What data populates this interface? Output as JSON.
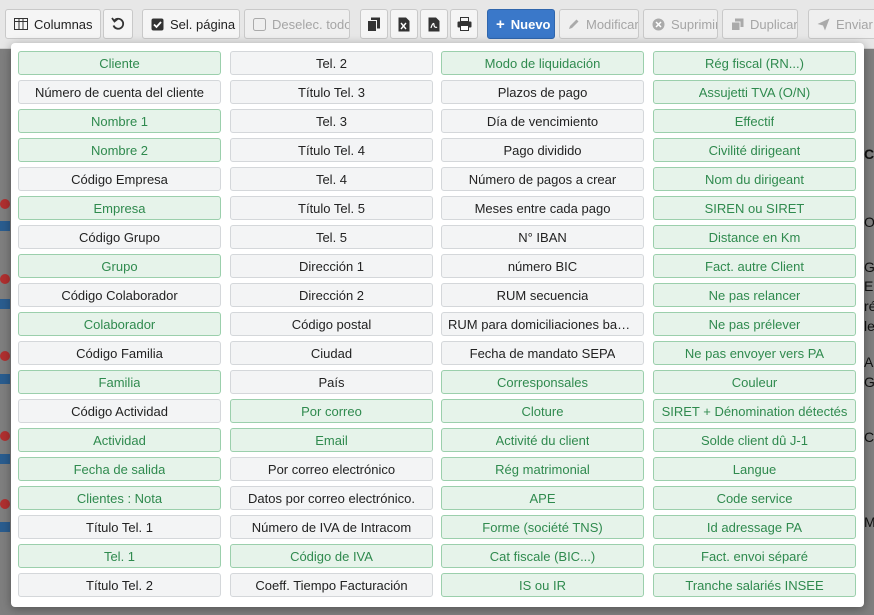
{
  "toolbar": {
    "columns_label": "Columnas",
    "select_page_label": "Sel. página",
    "deselect_all_label": "Deselec. todo",
    "new_label": "Nuevo",
    "modify_label": "Modificar",
    "delete_label": "Suprimir",
    "duplicate_label": "Duplicar",
    "send_label": "Enviar"
  },
  "background": {
    "letters": [
      "C",
      "O",
      "G",
      "E",
      "ré",
      "le",
      "A",
      "G",
      "C",
      "M"
    ]
  },
  "columns": [
    [
      {
        "label": "Cliente",
        "selected": true
      },
      {
        "label": "Número de cuenta del cliente",
        "selected": false
      },
      {
        "label": "Nombre 1",
        "selected": true
      },
      {
        "label": "Nombre 2",
        "selected": true
      },
      {
        "label": "Código Empresa",
        "selected": false
      },
      {
        "label": "Empresa",
        "selected": true
      },
      {
        "label": "Código Grupo",
        "selected": false
      },
      {
        "label": "Grupo",
        "selected": true
      },
      {
        "label": "Código Colaborador",
        "selected": false
      },
      {
        "label": "Colaborador",
        "selected": true
      },
      {
        "label": "Código Familia",
        "selected": false
      },
      {
        "label": "Familia",
        "selected": true
      },
      {
        "label": "Código Actividad",
        "selected": false
      },
      {
        "label": "Actividad",
        "selected": true
      },
      {
        "label": "Fecha de salida",
        "selected": true
      },
      {
        "label": "Clientes : Nota",
        "selected": true
      },
      {
        "label": "Título Tel. 1",
        "selected": false
      },
      {
        "label": "Tel. 1",
        "selected": true
      },
      {
        "label": "Título Tel. 2",
        "selected": false
      }
    ],
    [
      {
        "label": "Tel. 2",
        "selected": false
      },
      {
        "label": "Título Tel. 3",
        "selected": false
      },
      {
        "label": "Tel. 3",
        "selected": false
      },
      {
        "label": "Título Tel. 4",
        "selected": false
      },
      {
        "label": "Tel. 4",
        "selected": false
      },
      {
        "label": "Título Tel. 5",
        "selected": false
      },
      {
        "label": "Tel. 5",
        "selected": false
      },
      {
        "label": "Dirección 1",
        "selected": false
      },
      {
        "label": "Dirección 2",
        "selected": false
      },
      {
        "label": "Código postal",
        "selected": false
      },
      {
        "label": "Ciudad",
        "selected": false
      },
      {
        "label": "País",
        "selected": false
      },
      {
        "label": "Por correo",
        "selected": true
      },
      {
        "label": "Email",
        "selected": true
      },
      {
        "label": "Por correo electrónico",
        "selected": false
      },
      {
        "label": "Datos por correo electrónico.",
        "selected": false
      },
      {
        "label": "Número de IVA de Intracom",
        "selected": false
      },
      {
        "label": "Código de IVA",
        "selected": true
      },
      {
        "label": "Coeff. Tiempo Facturación",
        "selected": false
      }
    ],
    [
      {
        "label": "Modo de liquidación",
        "selected": true
      },
      {
        "label": "Plazos de pago",
        "selected": false
      },
      {
        "label": "Día de vencimiento",
        "selected": false
      },
      {
        "label": "Pago dividido",
        "selected": false
      },
      {
        "label": "Número de pagos a crear",
        "selected": false
      },
      {
        "label": "Meses entre cada pago",
        "selected": false
      },
      {
        "label": "N° IBAN",
        "selected": false
      },
      {
        "label": "número BIC",
        "selected": false
      },
      {
        "label": "RUM secuencia",
        "selected": false
      },
      {
        "label": "RUM para domiciliaciones bancarias",
        "selected": false
      },
      {
        "label": "Fecha de mandato SEPA",
        "selected": false
      },
      {
        "label": "Corresponsales",
        "selected": true
      },
      {
        "label": "Cloture",
        "selected": true
      },
      {
        "label": "Activité du client",
        "selected": true
      },
      {
        "label": "Rég matrimonial",
        "selected": true
      },
      {
        "label": "APE",
        "selected": true
      },
      {
        "label": "Forme (société TNS)",
        "selected": true
      },
      {
        "label": "Cat fiscale (BIC...)",
        "selected": true
      },
      {
        "label": "IS ou IR",
        "selected": true
      }
    ],
    [
      {
        "label": "Rég fiscal (RN...)",
        "selected": true
      },
      {
        "label": "Assujetti TVA (O/N)",
        "selected": true
      },
      {
        "label": "Effectif",
        "selected": true
      },
      {
        "label": "Civilité dirigeant",
        "selected": true
      },
      {
        "label": "Nom du dirigeant",
        "selected": true
      },
      {
        "label": "SIREN ou SIRET",
        "selected": true
      },
      {
        "label": "Distance en Km",
        "selected": true
      },
      {
        "label": "Fact. autre Client",
        "selected": true
      },
      {
        "label": "Ne pas relancer",
        "selected": true
      },
      {
        "label": "Ne pas prélever",
        "selected": true
      },
      {
        "label": "Ne pas envoyer vers PA",
        "selected": true
      },
      {
        "label": "Couleur",
        "selected": true
      },
      {
        "label": "SIRET + Dénomination détectés",
        "selected": true
      },
      {
        "label": "Solde client dû J-1",
        "selected": true
      },
      {
        "label": "Langue",
        "selected": true
      },
      {
        "label": "Code service",
        "selected": true
      },
      {
        "label": "Id adressage PA",
        "selected": true
      },
      {
        "label": "Fact. envoi séparé",
        "selected": true
      },
      {
        "label": "Tranche salariés INSEE",
        "selected": true
      }
    ]
  ]
}
